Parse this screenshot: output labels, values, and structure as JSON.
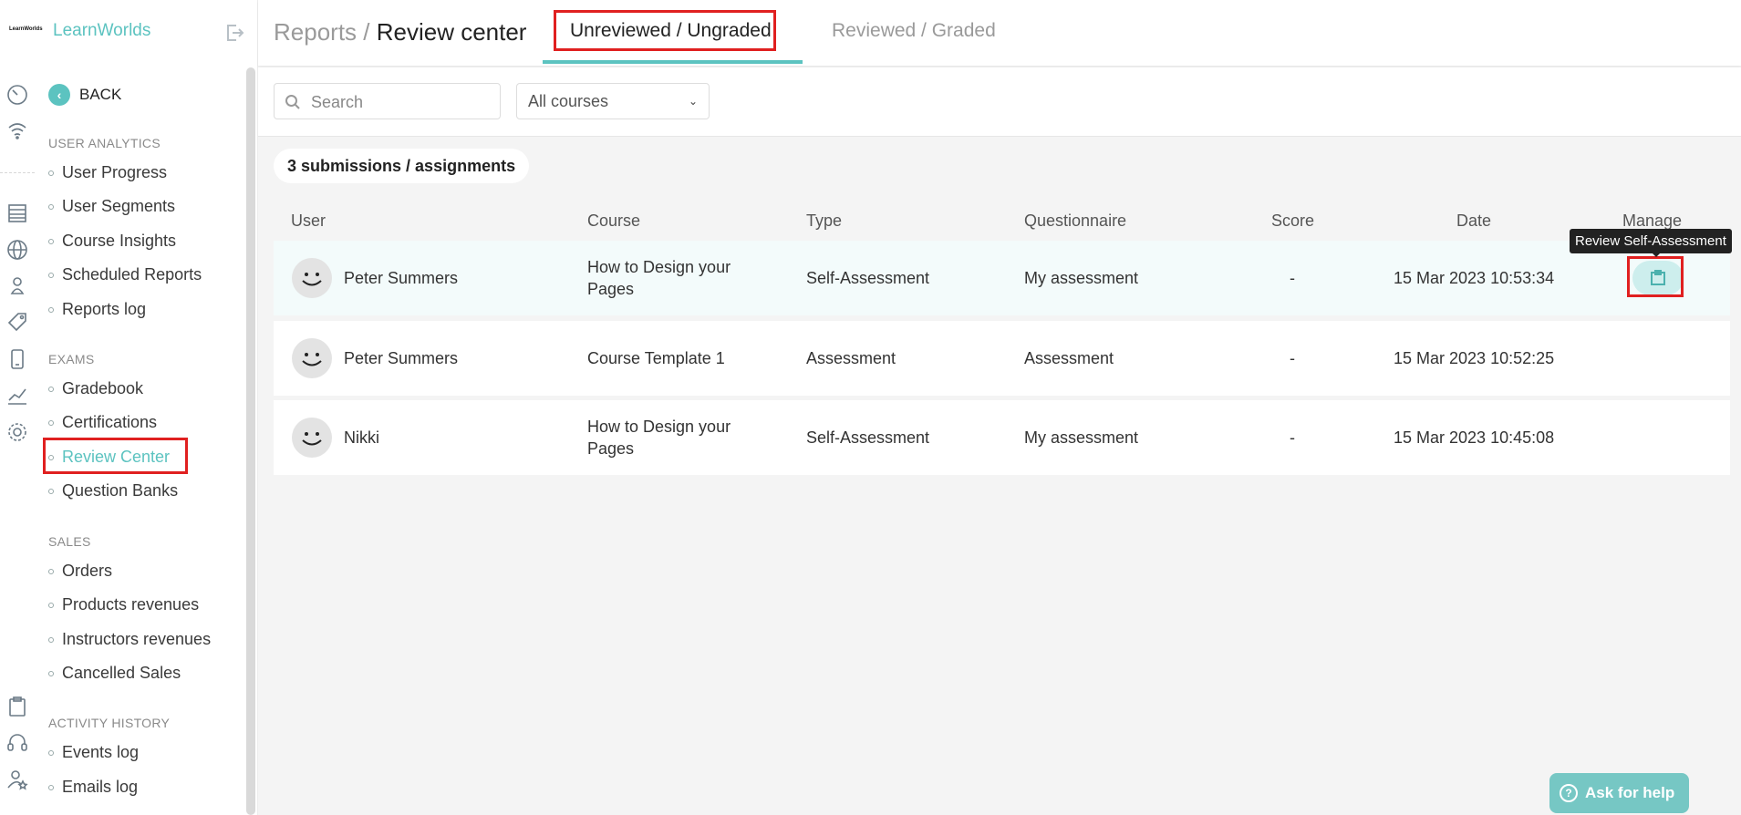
{
  "brand": {
    "name": "LearnWorlds",
    "mark": "LearnWorlds"
  },
  "sidebar": {
    "back_label": "BACK",
    "sections": [
      {
        "title": "USER ANALYTICS",
        "items": [
          "User Progress",
          "User Segments",
          "Course Insights",
          "Scheduled Reports",
          "Reports log"
        ]
      },
      {
        "title": "EXAMS",
        "items": [
          "Gradebook",
          "Certifications",
          "Review Center",
          "Question Banks"
        ]
      },
      {
        "title": "SALES",
        "items": [
          "Orders",
          "Products revenues",
          "Instructors revenues",
          "Cancelled Sales"
        ]
      },
      {
        "title": "ACTIVITY HISTORY",
        "items": [
          "Events log",
          "Emails log"
        ]
      }
    ],
    "active_item": "Review Center"
  },
  "header": {
    "crumb_parent": "Reports",
    "crumb_sep": " / ",
    "crumb_current": "Review center",
    "tabs": [
      {
        "label": "Unreviewed / Ungraded",
        "active": true
      },
      {
        "label": "Reviewed / Graded",
        "active": false
      }
    ]
  },
  "filters": {
    "search_placeholder": "Search",
    "course_select": "All courses"
  },
  "count_label": "3 submissions / assignments",
  "table": {
    "columns": [
      "User",
      "Course",
      "Type",
      "Questionnaire",
      "Score",
      "Date",
      "Manage"
    ],
    "rows": [
      {
        "user": "Peter Summers",
        "course_line1": "How to Design your",
        "course_line2": "Pages",
        "type": "Self-Assessment",
        "questionnaire": "My assessment",
        "score": "-",
        "date": "15 Mar 2023 10:53:34"
      },
      {
        "user": "Peter Summers",
        "course_line1": "Course Template 1",
        "course_line2": "",
        "type": "Assessment",
        "questionnaire": "Assessment",
        "score": "-",
        "date": "15 Mar 2023 10:52:25"
      },
      {
        "user": "Nikki",
        "course_line1": "How to Design your",
        "course_line2": "Pages",
        "type": "Self-Assessment",
        "questionnaire": "My assessment",
        "score": "-",
        "date": "15 Mar 2023 10:45:08"
      }
    ]
  },
  "tooltip": "Review Self-Assessment",
  "help_button": "Ask for help",
  "colors": {
    "accent": "#5cc3c0",
    "highlight": "#e02020"
  }
}
